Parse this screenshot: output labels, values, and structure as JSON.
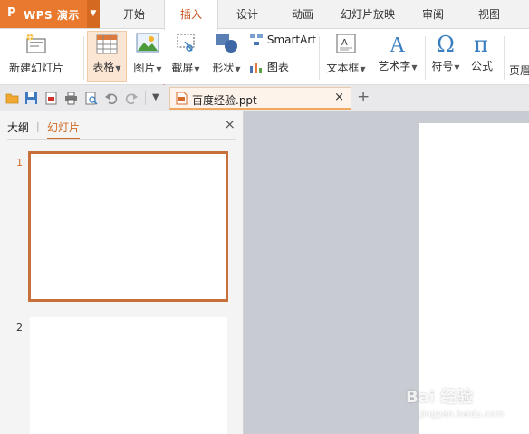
{
  "app": {
    "name": "WPS 演示",
    "logo": "P"
  },
  "tabs": [
    "开始",
    "插入",
    "设计",
    "动画",
    "幻灯片放映",
    "审阅",
    "视图"
  ],
  "ribbon": {
    "new_slide": "新建幻灯片",
    "table": "表格",
    "picture": "图片",
    "screenshot": "截屏",
    "shape": "形状",
    "smartart": "SmartArt",
    "chart": "图表",
    "textbox": "文本框",
    "wordart": "艺术字",
    "symbol": "符号",
    "formula": "公式",
    "header_footer": "页眉"
  },
  "document": {
    "filename": "百度经验.ppt"
  },
  "panel": {
    "tab_outline": "大纲",
    "tab_slides": "幻灯片",
    "divider": "|"
  },
  "slides": [
    "1",
    "2"
  ],
  "watermark": {
    "brand": "Bai 经验",
    "url": "jingyan.baidu.com"
  },
  "colors": {
    "accent": "#c8501f",
    "app_orange": "#e8792e"
  }
}
